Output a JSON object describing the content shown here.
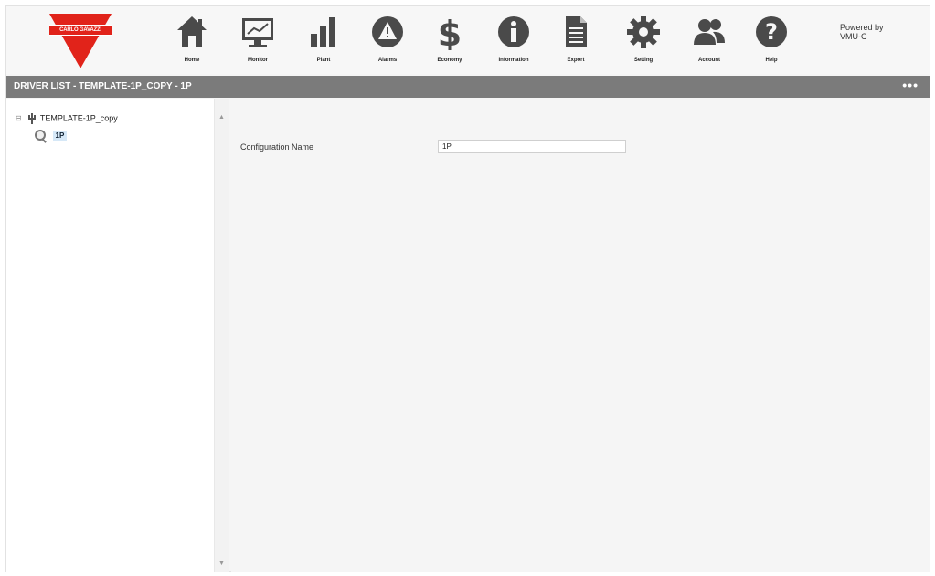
{
  "brand": {
    "logo_text": "CARLO GAVAZZI",
    "color": "#e1231a"
  },
  "nav": [
    {
      "label": "Home",
      "icon": "home-icon"
    },
    {
      "label": "Monitor",
      "icon": "monitor-icon"
    },
    {
      "label": "Plant",
      "icon": "bar-chart-icon"
    },
    {
      "label": "Alarms",
      "icon": "alarm-icon"
    },
    {
      "label": "Economy",
      "icon": "dollar-icon"
    },
    {
      "label": "Information",
      "icon": "info-icon"
    },
    {
      "label": "Export",
      "icon": "document-icon"
    },
    {
      "label": "Setting",
      "icon": "gear-icon"
    },
    {
      "label": "Account",
      "icon": "users-icon"
    },
    {
      "label": "Help",
      "icon": "help-icon"
    }
  ],
  "powered_by": {
    "line1": "Powered by",
    "line2": "VMU-C"
  },
  "breadcrumb": {
    "text": "DRIVER LIST - TEMPLATE-1P_COPY - 1P",
    "more": "•••"
  },
  "tree": {
    "root_label": "TEMPLATE-1P_copy",
    "child_label": "1P"
  },
  "form": {
    "config_name_label": "Configuration Name",
    "config_name_value": "1P"
  },
  "colors": {
    "header_bg": "#f7f7f7",
    "crumb_bg": "#7b7b7b",
    "icon": "#4a4a4a"
  }
}
